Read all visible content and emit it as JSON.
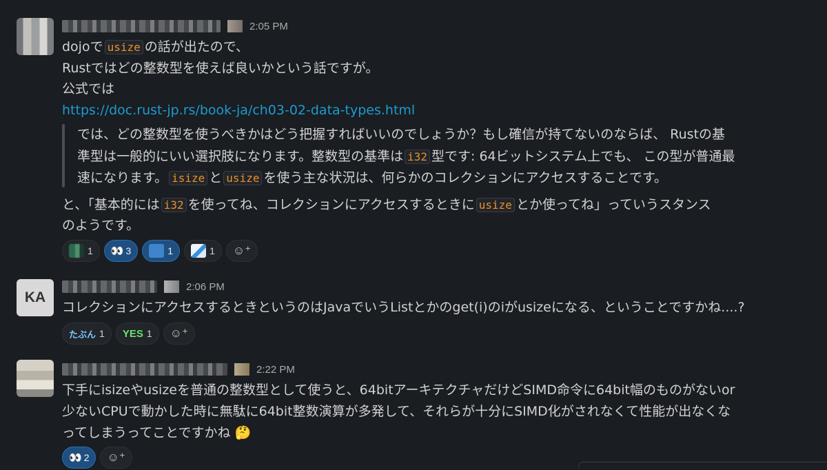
{
  "messages": [
    {
      "time": "2:05 PM",
      "l1_a": "dojoで",
      "l1_code": "usize",
      "l1_b": "の話が出たので、",
      "l2": "Rustではどの整数型を使えば良いかという話ですが。",
      "l3": "公式では",
      "link": "https://doc.rust-jp.rs/book-ja/ch03-02-data-types.html",
      "q1": "では、どの整数型を使うべきかはどう把握すればいいのでしょうか？もし確信が持てないのならば、 Rustの基",
      "q2_a": "準型は一般的にいい選択肢になります。整数型の基準は",
      "q2_code": "i32",
      "q2_b": "型です: 64ビットシステム上でも、 この型が普通最",
      "q3_a": "速になります。",
      "q3_code1": "isize",
      "q3_mid": "と",
      "q3_code2": "usize",
      "q3_b": "を使う主な状況は、何らかのコレクションにアクセスすることです。",
      "l4_a": "と、「基本的には",
      "l4_code1": "i32",
      "l4_mid": "を使ってね、コレクションにアクセスするときに",
      "l4_code2": "usize",
      "l4_b": "とか使ってね」っていうスタンス",
      "l5": "のようです。",
      "reactions": [
        {
          "emoji": "pixelated-emoji",
          "count": "1"
        },
        {
          "emoji": "👀",
          "count": "3"
        },
        {
          "emoji": "kanji-emoji",
          "count": "1"
        },
        {
          "emoji": "map-emoji",
          "count": "1"
        }
      ]
    },
    {
      "avatar_initials": "KA",
      "time": "2:06 PM",
      "text": "コレクションにアクセスするときというのはJavaでいうListとかのget(i)のiがusizeになる、ということですかね....?",
      "reactions": [
        {
          "emoji": "たぶん",
          "count": "1"
        },
        {
          "emoji": "YES",
          "count": "1"
        }
      ]
    },
    {
      "time": "2:22 PM",
      "l1": "下手にisizeやusizeを普通の整数型として使うと、64bitアーキテクチャだけどSIMD命令に64bit幅のものがないor",
      "l2": "少ないCPUで動かした時に無駄に64bit整数演算が多発して、それらが十分にSIMD化がされなくて性能が出なくな",
      "l3": "ってしまうってことですかね 🤔",
      "reactions": [
        {
          "emoji": "👀",
          "count": "2"
        }
      ]
    }
  ],
  "add_reaction_icon": "add-reaction-icon",
  "colors": {
    "background": "#1a1d21",
    "link": "#1d9bd1",
    "code": "#e8912d",
    "my_reaction": "#1f4f80"
  }
}
